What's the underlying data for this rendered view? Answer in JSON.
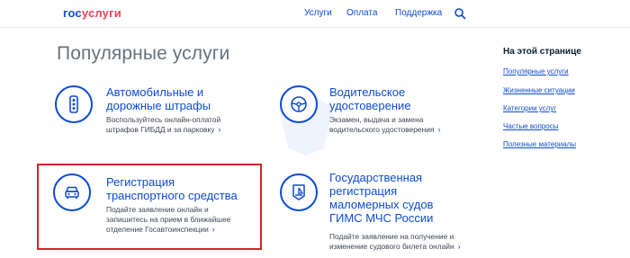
{
  "header": {
    "logo_part1": "гос",
    "logo_part2": "услуги",
    "nav": {
      "services": "Услуги",
      "payment": "Оплата",
      "support": "Поддержка"
    },
    "search_icon": "search-icon"
  },
  "main": {
    "title": "Популярные услуги",
    "services": [
      {
        "title_line1": "Автомобильные и",
        "title_line2": "дорожные штрафы",
        "desc_line1": "Воспользуйтесь онлайн-оплатой",
        "desc_line2": "штрафов ГИБДД и за парковку",
        "icon": "traffic-light-icon"
      },
      {
        "title_line1": "Водительское",
        "title_line2": "удостоверение",
        "desc_line1": "Экзамен, выдача и замена",
        "desc_line2": "водительского удостоверения",
        "icon": "steering-wheel-icon"
      },
      {
        "title_line1": "Регистрация",
        "title_line2": "транспортного средства",
        "desc_line1": "Подайте заявление онлайн и",
        "desc_line2": "запишитесь на прием в ближайшее",
        "desc_line3": "отделение Госавтоинспекции",
        "icon": "car-icon"
      },
      {
        "title_line1": "Государственная",
        "title_line2": "регистрация",
        "title_line3": "маломерных судов",
        "title_line4": "ГИМС МЧС России",
        "desc_line1": "Подайте заявление на получение и",
        "desc_line2": "изменение судового билета онлайн",
        "icon": "boat-icon"
      }
    ]
  },
  "sidebar": {
    "title": "На этой странице",
    "links": [
      "Популярные услуги",
      "Жизненные ситуации",
      "Категории услуг",
      "Частые вопросы",
      "Полезные материалы"
    ]
  },
  "colors": {
    "brand_blue": "#0d4cd3",
    "brand_red": "#ee3f58",
    "highlight": "#d8232a"
  }
}
